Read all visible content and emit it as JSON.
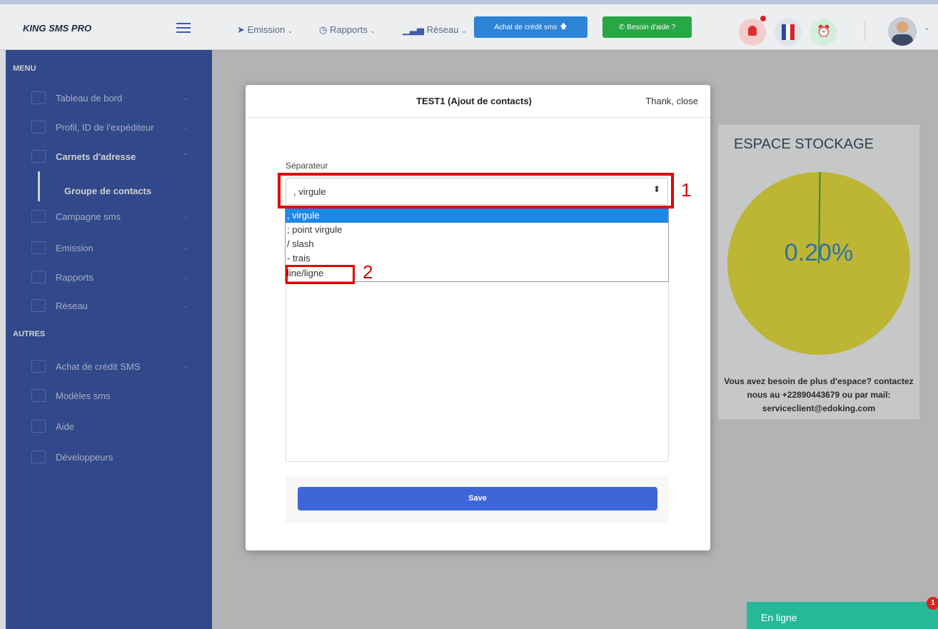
{
  "topbar": {
    "brand": "KING SMS PRO",
    "nav_emission": "Emission",
    "nav_rapports": "Rapports",
    "nav_reseau": "Réseau",
    "btn_credit": "Achat de crédit sms",
    "btn_help": "Besoin d'aide ?"
  },
  "sidebar": {
    "menu_title": "MENU",
    "items": [
      {
        "label": "Tableau de bord"
      },
      {
        "label": "Profil, ID de l'expéditeur"
      },
      {
        "label": "Carnets d'adresse"
      },
      {
        "label": "Groupe de contacts"
      },
      {
        "label": "Campagne sms"
      },
      {
        "label": "Emission"
      },
      {
        "label": "Rapports"
      },
      {
        "label": "Réseau"
      }
    ],
    "other_title": "AUTRES",
    "other_items": [
      {
        "label": "Achat de crédit SMS"
      },
      {
        "label": "Modèles sms"
      },
      {
        "label": "Aide"
      },
      {
        "label": "Développeurs"
      }
    ]
  },
  "storage": {
    "title": "ESPACE STOCKAGE",
    "percent": "0.20%",
    "percent_value": 0.2,
    "message": "Vous avez besoin de plus d'espace? contactez nous au +22890443679 ou par mail: serviceclient@edoking.com"
  },
  "modal": {
    "title": "TEST1 (Ajout de contacts)",
    "close": "Thank, close",
    "separator_label": "Séparateur",
    "selected": ", virgule",
    "options": [
      ", virgule",
      "; point virgule",
      "/ slash",
      "- trais",
      "line/ligne"
    ],
    "save": "Save"
  },
  "annotations": {
    "one": "1",
    "two": "2"
  },
  "chat": {
    "label": "En ligne",
    "badge": "1"
  },
  "colors": {
    "sidebar": "#2b4aa3",
    "primary": "#3d67d9",
    "green": "#28a745",
    "blue_btn": "#2d84d6",
    "pie": "#e7dc2f"
  }
}
